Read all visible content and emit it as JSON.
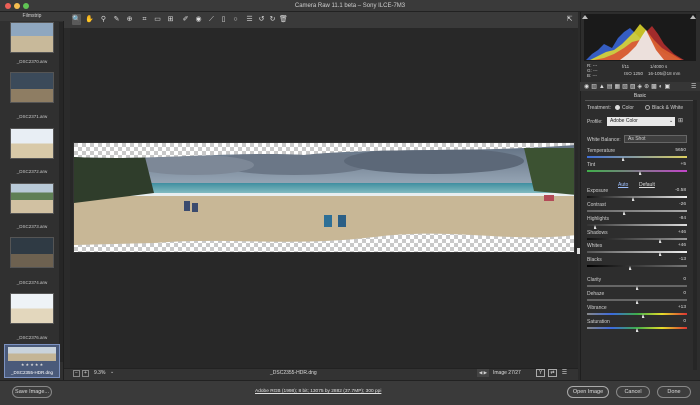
{
  "window": {
    "title": "Camera Raw 11.1 beta  –  Sony ILCE-7M3"
  },
  "colors": {
    "accent": "#4a7fd3",
    "traffic_red": "#ec5f57",
    "traffic_yellow": "#f5be4f",
    "traffic_green": "#60c454"
  },
  "toolbar": {
    "tools": [
      "zoom-tool",
      "hand-tool",
      "white-balance-tool",
      "color-sampler-tool",
      "targeted-adjustment-tool",
      "crop-tool",
      "straighten-tool",
      "transform-tool",
      "spot-removal-tool",
      "red-eye-tool",
      "adjustment-brush",
      "graduated-filter",
      "radial-filter",
      "preferences",
      "rotate-left",
      "rotate-right",
      "trash"
    ]
  },
  "filmstrip": {
    "title": "Filmstrip",
    "items": [
      {
        "name": "_DSC2370.arw"
      },
      {
        "name": "_DSC2371.arw"
      },
      {
        "name": "_DSC2372.arw"
      },
      {
        "name": "_DSC2373.arw"
      },
      {
        "name": "_DSC2374.arw"
      },
      {
        "name": "_DSC2376.arw"
      },
      {
        "name": "_DSC2355-HDR.dng"
      }
    ],
    "selected_rating": "★ ★ ★ ★ ★"
  },
  "status": {
    "zoom": "9.3%",
    "filename": "_DSC2355-HDR.dng",
    "image_counter": "Image 27/27"
  },
  "footer": {
    "save_label": "Save Image...",
    "workflow_link": "Adobe RGB (1998); 8 bit; 13075 by 2882 (37.7MP); 300 ppi",
    "open_label": "Open Image",
    "cancel_label": "Cancel",
    "done_label": "Done"
  },
  "info": {
    "r": "R:",
    "g": "G:",
    "b": "B:",
    "dash": "---",
    "aperture": "f/11",
    "shutter": "1/4000 s",
    "iso": "ISO 1250",
    "lens": "16-105@18 mm"
  },
  "panel": {
    "name": "Basic",
    "treatment_label": "Treatment:",
    "treatment_color": "Color",
    "treatment_bw": "Black & White",
    "profile_label": "Profile:",
    "profile_value": "Adobe Color",
    "wb_label": "White Balance:",
    "wb_value": "As Shot",
    "auto_label": "Auto",
    "default_label": "Default",
    "sliders": [
      {
        "label": "Temperature",
        "value": "5650",
        "pos": 0.36
      },
      {
        "label": "Tint",
        "value": "+5",
        "pos": 0.53
      },
      {
        "label": "Exposure",
        "value": "-0.58",
        "pos": 0.46
      },
      {
        "label": "Contrast",
        "value": "-26",
        "pos": 0.37
      },
      {
        "label": "Highlights",
        "value": "-84",
        "pos": 0.08
      },
      {
        "label": "Shadows",
        "value": "+46",
        "pos": 0.73
      },
      {
        "label": "Whites",
        "value": "+46",
        "pos": 0.73
      },
      {
        "label": "Blacks",
        "value": "-13",
        "pos": 0.43
      },
      {
        "label": "Clarity",
        "value": "0",
        "pos": 0.5
      },
      {
        "label": "Dehaze",
        "value": "0",
        "pos": 0.5
      },
      {
        "label": "Vibrance",
        "value": "+13",
        "pos": 0.56
      },
      {
        "label": "Saturation",
        "value": "0",
        "pos": 0.5
      }
    ]
  }
}
